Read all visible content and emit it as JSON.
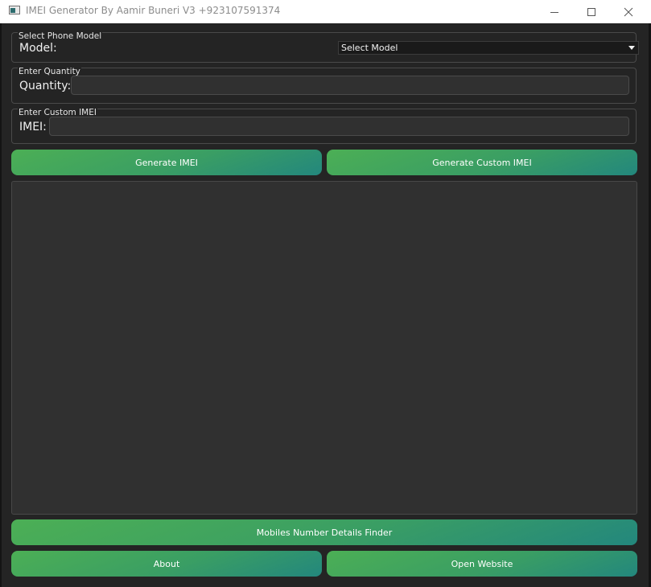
{
  "window": {
    "title": "IMEI Generator By Aamir Buneri V3 +923107591374",
    "controls": {
      "minimize": "minimize-icon",
      "maximize": "maximize-icon",
      "close": "close-icon"
    }
  },
  "phone_model_group": {
    "title": "Select Phone Model",
    "label": "Model:",
    "select_value": "Select Model"
  },
  "quantity_group": {
    "title": "Enter Quantity",
    "label": "Quantity:",
    "value": ""
  },
  "custom_imei_group": {
    "title": "Enter Custom IMEI",
    "label": "IMEI:",
    "value": ""
  },
  "buttons": {
    "generate_imei": "Generate IMEI",
    "generate_custom_imei": "Generate Custom IMEI",
    "mobile_number_finder": "Mobiles Number Details Finder",
    "about": "About",
    "open_website": "Open Website"
  },
  "output": {
    "text": ""
  },
  "colors": {
    "background": "#242424",
    "field": "#303030",
    "button_start": "#4caf55",
    "button_end": "#23877d",
    "text": "#ffffff"
  }
}
